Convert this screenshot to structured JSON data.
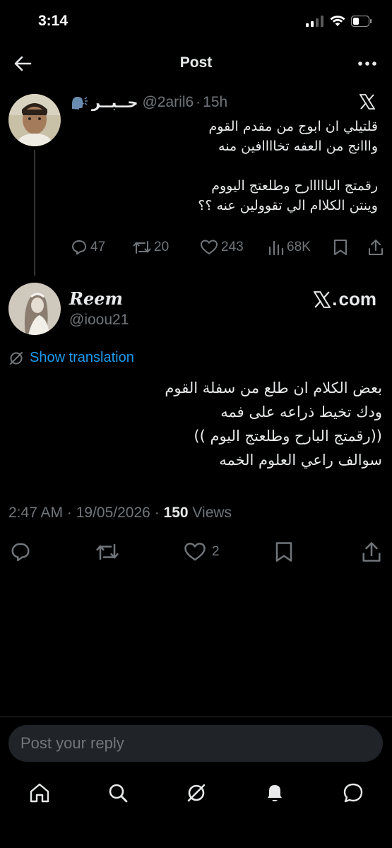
{
  "status": {
    "time": "3:14"
  },
  "header": {
    "title": "Post"
  },
  "quoted": {
    "name": "حــبــر",
    "handle": "@2aril6",
    "sep": "·",
    "time": "15h",
    "text_lines": [
      "قلتيلي ان ابوج من مقدم القوم",
      "وااانج من العفه تخاااافين منه",
      "",
      "رقمتج البااااارح وطلعتج اليووم",
      "وينتن الكلاام الي تقوولين عنه ؟؟"
    ],
    "replies": "47",
    "reposts": "20",
    "likes": "243",
    "views": "68K"
  },
  "post": {
    "name": "Reem",
    "handle": "@ioou21",
    "xcom": "com",
    "translate_label": "Show translation",
    "text_lines": [
      "بعض الكلام ان طلع من سفلة القوم",
      "ودك تخيط ذراعه على فمه",
      "((رقمتج البارح وطلعتج اليوم ))",
      "سوالف راعي العلوم الخمه"
    ],
    "time": "2:47 AM",
    "date": "19/05/2026",
    "views_count": "150",
    "views_label": "Views",
    "likes": "2"
  },
  "reply": {
    "placeholder": "Post your reply"
  },
  "colors": {
    "accent": "#1d9bf0",
    "muted": "#71767b",
    "text": "#e7e9ea",
    "background": "#000000"
  },
  "icons": [
    "back-arrow-icon",
    "more-icon",
    "x-logo-icon",
    "reply-icon",
    "repost-icon",
    "like-icon",
    "views-icon",
    "bookmark-icon",
    "share-icon",
    "translate-icon",
    "home-icon",
    "search-icon",
    "grok-icon",
    "notifications-icon",
    "messages-icon"
  ]
}
